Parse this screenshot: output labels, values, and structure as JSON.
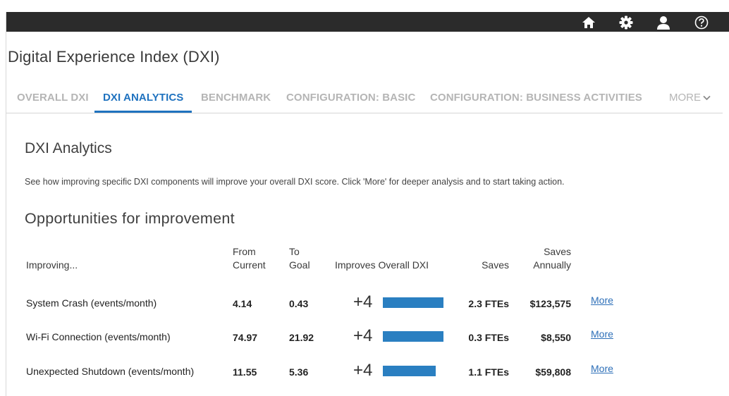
{
  "icons": [
    "home-icon",
    "gear-icon",
    "user-icon",
    "help-icon"
  ],
  "colors": {
    "accent": "#1f72bf",
    "bar": "#2a7fc1",
    "topbar": "#2b2b2b",
    "link": "#2d6fb8"
  },
  "app": {
    "title": "Digital Experience Index (DXI)"
  },
  "tabs": [
    {
      "label": "OVERALL DXI",
      "active": false
    },
    {
      "label": "DXI ANALYTICS",
      "active": true
    },
    {
      "label": "BENCHMARK",
      "active": false
    },
    {
      "label": "CONFIGURATION: BASIC",
      "active": false
    },
    {
      "label": "CONFIGURATION: BUSINESS ACTIVITIES",
      "active": false
    }
  ],
  "more_tab": {
    "label": "MORE"
  },
  "section": {
    "title": "DXI Analytics",
    "description": "See how improving specific DXI components will improve your overall DXI score. Click 'More' for deeper analysis and to start taking action."
  },
  "opportunities": {
    "title": "Opportunities for improvement",
    "headers": {
      "improving": "Improving...",
      "from_line1": "From",
      "from_line2": "Current",
      "to_line1": "To",
      "to_line2": "Goal",
      "improves": "Improves Overall DXI",
      "saves": "Saves",
      "saves_annually_line1": "Saves",
      "saves_annually_line2": "Annually"
    },
    "rows": [
      {
        "component": "System Crash (events/month)",
        "from": "4.14",
        "to": "0.43",
        "improves": "+4",
        "improves_fraction": 1.0,
        "saves": "2.3 FTEs",
        "saves_annually": "$123,575",
        "more": "More"
      },
      {
        "component": "Wi-Fi Connection (events/month)",
        "from": "74.97",
        "to": "21.92",
        "improves": "+4",
        "improves_fraction": 1.0,
        "saves": "0.3 FTEs",
        "saves_annually": "$8,550",
        "more": "More"
      },
      {
        "component": "Unexpected Shutdown (events/month)",
        "from": "11.55",
        "to": "5.36",
        "improves": "+4",
        "improves_fraction": 0.87,
        "saves": "1.1 FTEs",
        "saves_annually": "$59,808",
        "more": "More"
      }
    ]
  }
}
